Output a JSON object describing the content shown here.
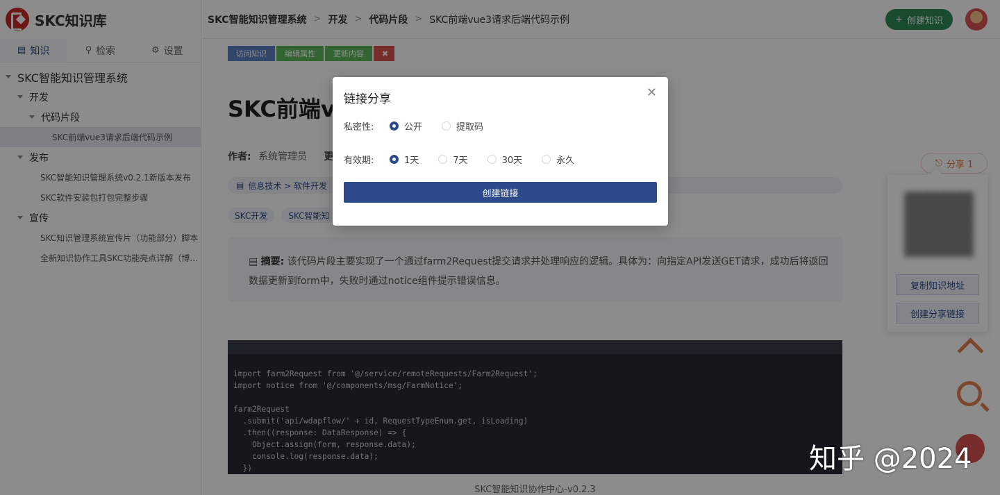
{
  "app": {
    "name": "SKC知识库"
  },
  "sidebar": {
    "tabs": [
      {
        "icon": "book-icon",
        "label": "知识"
      },
      {
        "icon": "search-icon",
        "label": "检索"
      },
      {
        "icon": "gear-icon",
        "label": "设置"
      }
    ],
    "tree": {
      "root": "SKC智能知识管理系统",
      "dev": "开发",
      "snippets": "代码片段",
      "snippet_item": "SKC前端vue3请求后端代码示例",
      "release": "发布",
      "release_item1": "SKC智能知识管理系统v0.2.1新版本发布",
      "release_item2": "SKC软件安装包打包完整步骤",
      "promo": "宣传",
      "promo_item1": "SKC知识管理系统宣传片（功能部分）脚本",
      "promo_item2": "全新知识协作工具SKC功能亮点详解（博…"
    }
  },
  "header": {
    "breadcrumb": [
      "SKC智能知识管理系统",
      "开发",
      "代码片段",
      "SKC前端vue3请求后端代码示例"
    ],
    "create_label": "创建知识"
  },
  "toolbar": {
    "visit": "访问知识",
    "edit": "编辑属性",
    "update": "更新内容"
  },
  "doc": {
    "title_partial": "SKC前端vu",
    "author_label": "作者:",
    "author": "系统管理员",
    "update_label": "更",
    "category": "信息技术 > 软件开发",
    "tags": [
      "SKC开发",
      "SKC智能知"
    ],
    "summary_label": "摘要:",
    "summary": "该代码片段主要实现了一个通过farm2Request提交请求并处理响应的逻辑。具体为：向指定API发送GET请求，成功后将返回数据更新到form中，失败时通过notice组件提示错误信息。",
    "code": "import farm2Request from '@/service/remoteRequests/Farm2Request';\nimport notice from '@/components/msg/FarmNotice';\n\nfarm2Request\n  .submit('api/wdapflow/' + id, RequestTypeEnum.get, isLoading)\n  .then((response: DataResponse) => {\n    Object.assign(form, response.data);\n    console.log(response.data);\n  })",
    "footer": "SKC智能知识协作中心-v0.2.3"
  },
  "share": {
    "pill_label": "分享 1",
    "copy_label": "复制知识地址",
    "create_label": "创建分享链接"
  },
  "watermark": "知乎 @2024",
  "modal": {
    "title": "链接分享",
    "privacy_label": "私密性:",
    "privacy_options": [
      "公开",
      "提取码"
    ],
    "privacy_selected": "公开",
    "valid_label": "有效期:",
    "valid_options": [
      "1天",
      "7天",
      "30天",
      "永久"
    ],
    "valid_selected": "1天",
    "submit_label": "创建链接"
  },
  "colors": {
    "primary": "#2d4a8a",
    "success": "#2e8b57",
    "accent": "#e08050",
    "danger": "#d9534f"
  }
}
